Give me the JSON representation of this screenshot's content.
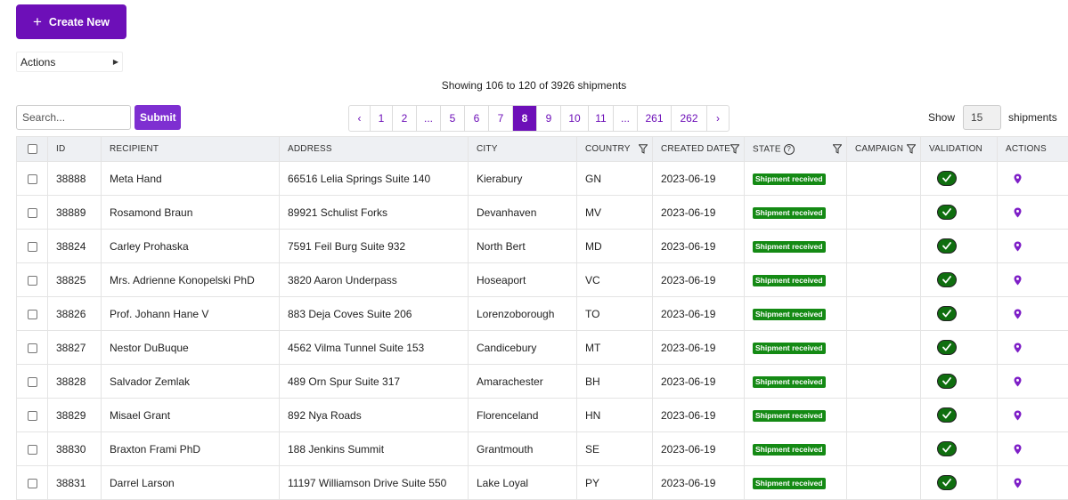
{
  "toolbar": {
    "create_label": "Create New",
    "actions_label": "Actions",
    "showing_text": "Showing 106 to 120 of 3926 shipments",
    "search_placeholder": "Search...",
    "submit_label": "Submit",
    "show_label": "Show",
    "show_value": "15",
    "shipments_label": "shipments"
  },
  "pagination": {
    "prev": "‹",
    "next": "›",
    "pages": [
      "1",
      "2",
      "...",
      "5",
      "6",
      "7",
      "8",
      "9",
      "10",
      "11",
      "...",
      "261",
      "262"
    ],
    "active": "8"
  },
  "table": {
    "columns": {
      "id": "ID",
      "recipient": "RECIPIENT",
      "address": "ADDRESS",
      "city": "CITY",
      "country": "COUNTRY",
      "created": "CREATED DATE",
      "state": "STATE",
      "campaign": "CAMPAIGN",
      "validation": "VALIDATION",
      "actions": "ACTIONS"
    },
    "rows": [
      {
        "id": "38888",
        "recipient": "Meta Hand",
        "address": "66516 Lelia Springs Suite 140",
        "city": "Kierabury",
        "country": "GN",
        "created": "2023-06-19",
        "state": "Shipment received",
        "campaign": ""
      },
      {
        "id": "38889",
        "recipient": "Rosamond Braun",
        "address": "89921 Schulist Forks",
        "city": "Devanhaven",
        "country": "MV",
        "created": "2023-06-19",
        "state": "Shipment received",
        "campaign": ""
      },
      {
        "id": "38824",
        "recipient": "Carley Prohaska",
        "address": "7591 Feil Burg Suite 932",
        "city": "North Bert",
        "country": "MD",
        "created": "2023-06-19",
        "state": "Shipment received",
        "campaign": ""
      },
      {
        "id": "38825",
        "recipient": "Mrs. Adrienne Konopelski PhD",
        "address": "3820 Aaron Underpass",
        "city": "Hoseaport",
        "country": "VC",
        "created": "2023-06-19",
        "state": "Shipment received",
        "campaign": ""
      },
      {
        "id": "38826",
        "recipient": "Prof. Johann Hane V",
        "address": "883 Deja Coves Suite 206",
        "city": "Lorenzoborough",
        "country": "TO",
        "created": "2023-06-19",
        "state": "Shipment received",
        "campaign": ""
      },
      {
        "id": "38827",
        "recipient": "Nestor DuBuque",
        "address": "4562 Vilma Tunnel Suite 153",
        "city": "Candicebury",
        "country": "MT",
        "created": "2023-06-19",
        "state": "Shipment received",
        "campaign": ""
      },
      {
        "id": "38828",
        "recipient": "Salvador Zemlak",
        "address": "489 Orn Spur Suite 317",
        "city": "Amarachester",
        "country": "BH",
        "created": "2023-06-19",
        "state": "Shipment received",
        "campaign": ""
      },
      {
        "id": "38829",
        "recipient": "Misael Grant",
        "address": "892 Nya Roads",
        "city": "Florenceland",
        "country": "HN",
        "created": "2023-06-19",
        "state": "Shipment received",
        "campaign": ""
      },
      {
        "id": "38830",
        "recipient": "Braxton Frami PhD",
        "address": "188 Jenkins Summit",
        "city": "Grantmouth",
        "country": "SE",
        "created": "2023-06-19",
        "state": "Shipment received",
        "campaign": ""
      },
      {
        "id": "38831",
        "recipient": "Darrel Larson",
        "address": "11197 Williamson Drive Suite 550",
        "city": "Lake Loyal",
        "country": "PY",
        "created": "2023-06-19",
        "state": "Shipment received",
        "campaign": ""
      }
    ]
  },
  "icons": {
    "plus": "plus-icon",
    "caret": "caret-right-icon",
    "filter": "filter-icon",
    "help": "help-circle-icon",
    "check": "check-icon",
    "pin": "map-pin-icon"
  },
  "colors": {
    "brand": "#6d0fb8",
    "badge": "#148a14",
    "validation": "#0f6e0f"
  }
}
